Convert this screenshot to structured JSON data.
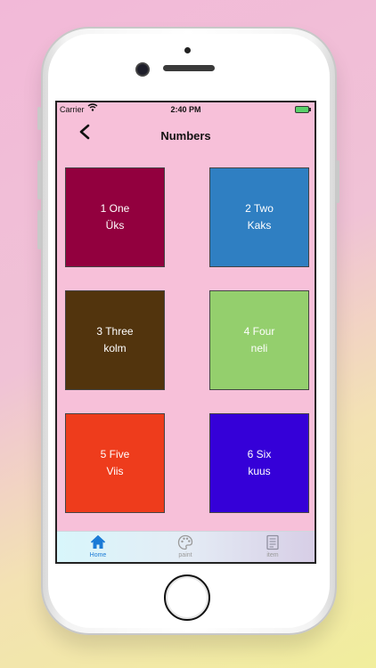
{
  "status_bar": {
    "carrier": "Carrier",
    "time": "2:40 PM"
  },
  "nav": {
    "title": "Numbers",
    "back_icon": "chevron-left-icon"
  },
  "tiles": [
    {
      "number": "1 One",
      "word": "Üks",
      "color": "#92003e"
    },
    {
      "number": "2 Two",
      "word": "Kaks",
      "color": "#2f7fc2"
    },
    {
      "number": "3 Three",
      "word": "kolm",
      "color": "#52340d"
    },
    {
      "number": "4 Four",
      "word": "neli",
      "color": "#94cf6d"
    },
    {
      "number": "5 Five",
      "word": "Viis",
      "color": "#ee3c1c"
    },
    {
      "number": "6 Six",
      "word": "kuus",
      "color": "#3500d8"
    }
  ],
  "tabs": [
    {
      "label": "Home",
      "icon": "home-icon",
      "color": "#1a7ad6"
    },
    {
      "label": "paint",
      "icon": "palette-icon",
      "color": "#9a9a9a"
    },
    {
      "label": "item",
      "icon": "notebook-icon",
      "color": "#9a9a9a"
    }
  ]
}
